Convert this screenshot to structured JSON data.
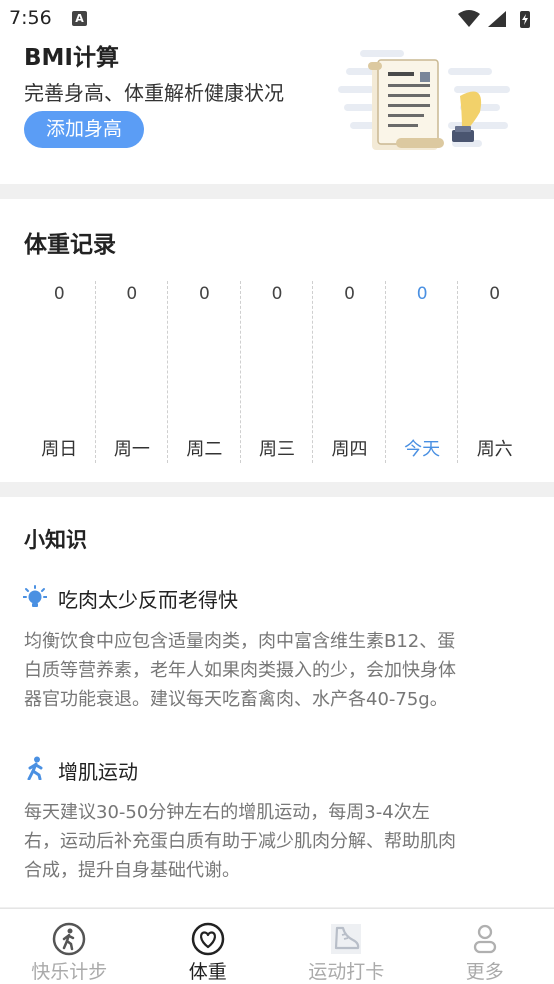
{
  "status": {
    "time": "7:56",
    "notification_letter": "A"
  },
  "bmi": {
    "title": "BMI计算",
    "subtitle": "完善身高、体重解析健康状况",
    "button_label": "添加身高"
  },
  "weight_record": {
    "title": "体重记录",
    "days": [
      {
        "value": "0",
        "label": "周日",
        "today": false
      },
      {
        "value": "0",
        "label": "周一",
        "today": false
      },
      {
        "value": "0",
        "label": "周二",
        "today": false
      },
      {
        "value": "0",
        "label": "周三",
        "today": false
      },
      {
        "value": "0",
        "label": "周四",
        "today": false
      },
      {
        "value": "0",
        "label": "今天",
        "today": true
      },
      {
        "value": "0",
        "label": "周六",
        "today": false
      }
    ]
  },
  "tips": {
    "title": "小知识",
    "items": [
      {
        "icon": "lightbulb-icon",
        "heading": "吃肉太少反而老得快",
        "lines": [
          "均衡饮食中应包含适量肉类，肉中富含维生素B12、蛋",
          "白质等营养素，老年人如果肉类摄入的少，会加快身体",
          "器官功能衰退。建议每天吃畜禽肉、水产各40-75g。"
        ]
      },
      {
        "icon": "running-person-icon",
        "heading": "增肌运动",
        "lines": [
          "每天建议30-50分钟左右的增肌运动，每周3-4次左",
          "右，运动后补充蛋白质有助于减少肌肉分解、帮助肌肉",
          "合成，提升自身基础代谢。"
        ]
      }
    ]
  },
  "tabbar": {
    "tabs": [
      {
        "label": "快乐计步",
        "icon": "walking-icon",
        "active": false
      },
      {
        "label": "体重",
        "icon": "heart-icon",
        "active": true
      },
      {
        "label": "运动打卡",
        "icon": "shoe-icon",
        "active": false
      },
      {
        "label": "更多",
        "icon": "person-icon",
        "active": false
      }
    ]
  },
  "colors": {
    "accent": "#5b9df5",
    "today": "#4a90e2",
    "background": "#f0f0f0"
  }
}
